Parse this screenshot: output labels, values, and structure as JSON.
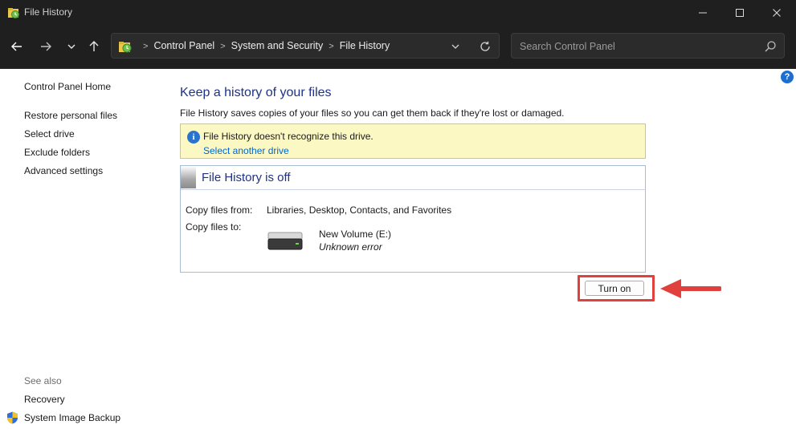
{
  "window": {
    "title": "File History"
  },
  "nav": {
    "breadcrumbs": [
      "Control Panel",
      "System and Security",
      "File History"
    ],
    "search_placeholder": "Search Control Panel"
  },
  "left_pane": {
    "home": "Control Panel Home",
    "links": [
      "Restore personal files",
      "Select drive",
      "Exclude folders",
      "Advanced settings"
    ],
    "see_also_label": "See also",
    "see_also_links": [
      "Recovery",
      "System Image Backup"
    ]
  },
  "main": {
    "heading": "Keep a history of your files",
    "subtitle": "File History saves copies of your files so you can get them back if they're lost or damaged.",
    "info": {
      "message": "File History doesn't recognize this drive.",
      "link": "Select another drive"
    },
    "status": {
      "title": "File History is off",
      "copy_from_label": "Copy files from:",
      "copy_from_value": "Libraries, Desktop, Contacts, and Favorites",
      "copy_to_label": "Copy files to:",
      "drive_name": "New Volume (E:)",
      "drive_status": "Unknown error"
    },
    "turn_on_label": "Turn on"
  },
  "colors": {
    "chrome_bg": "#1f1f1f",
    "heading_blue": "#1e3287",
    "link_blue": "#0066cc",
    "info_bg": "#fbf8c3",
    "highlight_red": "#e0413d"
  }
}
